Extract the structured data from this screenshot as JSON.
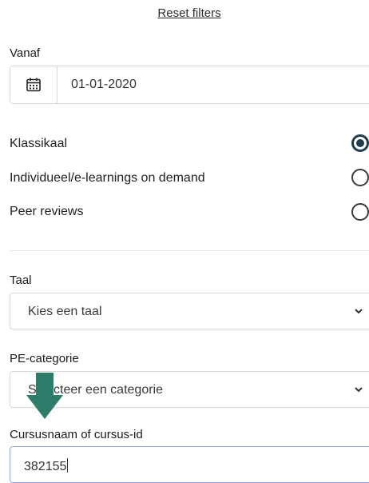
{
  "reset_filters": "Reset filters",
  "from_date": {
    "label": "Vanaf",
    "value": "01-01-2020",
    "icon": "calendar-icon"
  },
  "course_types": [
    {
      "label": "Klassikaal",
      "checked": true
    },
    {
      "label": "Individueel/e-learnings on demand",
      "checked": false
    },
    {
      "label": "Peer reviews",
      "checked": false
    }
  ],
  "language": {
    "label": "Taal",
    "placeholder": "Kies een taal"
  },
  "pe_category": {
    "label": "PE-categorie",
    "placeholder": "Selecteer een categorie"
  },
  "course_search": {
    "label": "Cursusnaam of cursus-id",
    "value": "382155"
  },
  "colors": {
    "accent": "#1d3e4b",
    "arrow": "#2e7d6b",
    "input_focus_border": "#8ea6e0"
  }
}
